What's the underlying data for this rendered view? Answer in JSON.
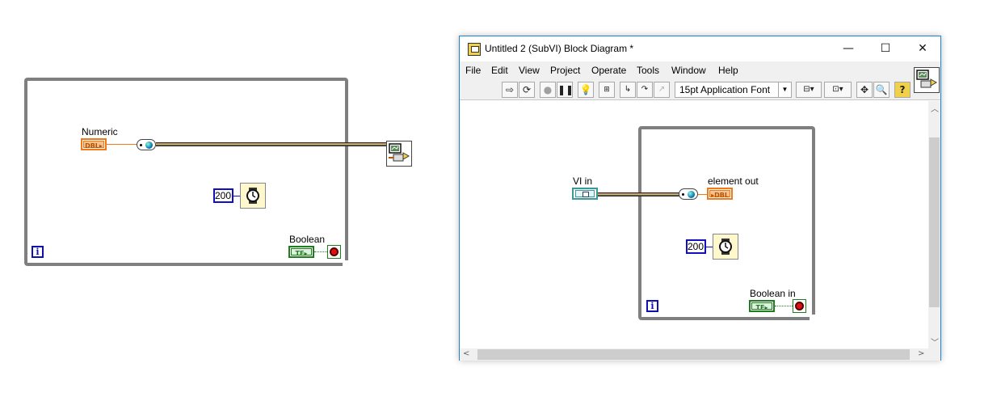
{
  "left_diagram": {
    "numeric_label": "Numeric",
    "numeric_type": "DBL",
    "boolean_label": "Boolean",
    "boolean_type": "TF",
    "wait_constant": "200",
    "iteration_terminal": "i"
  },
  "window": {
    "title": "Untitled 2 (SubVI) Block Diagram *",
    "controls": {
      "minimize": "—",
      "maximize": "☐",
      "close": "✕"
    },
    "menu": [
      "File",
      "Edit",
      "View",
      "Project",
      "Operate",
      "Tools",
      "Window",
      "Help"
    ],
    "toolbar": {
      "font": "15pt Application Font",
      "help": "?"
    },
    "diagram": {
      "vi_in_label": "VI in",
      "element_out_label": "element out",
      "element_out_type": "DBL",
      "boolean_in_label": "Boolean in",
      "boolean_type": "TF",
      "wait_constant": "200",
      "iteration_terminal": "i"
    }
  },
  "colors": {
    "dbl_orange": "#f07a1a",
    "boolean_green": "#1e7d1e",
    "integer_blue": "#1010c0",
    "loop_gray": "#7f7f7f",
    "window_border": "#1883d7"
  }
}
